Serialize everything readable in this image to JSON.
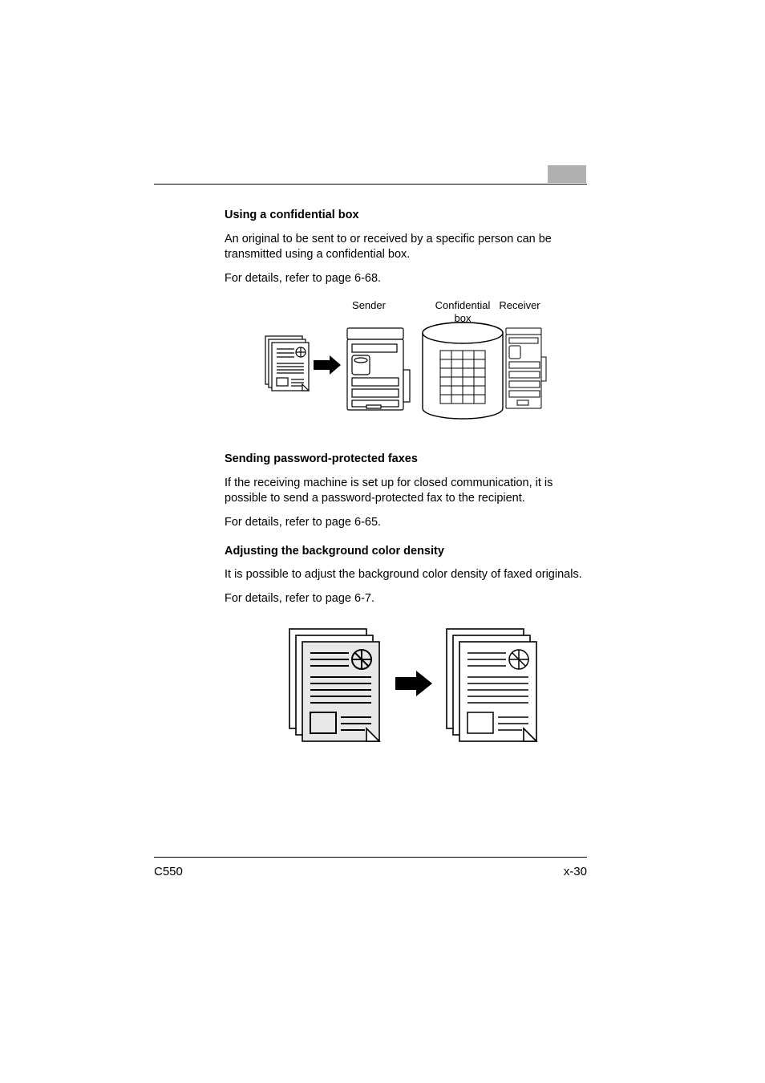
{
  "sections": {
    "s1": {
      "heading": "Using a confidential box",
      "p1": "An original to be sent to or received by a specific person can be transmitted using a confidential box.",
      "p2": "For details, refer to page 6-68."
    },
    "s2": {
      "heading": "Sending password-protected faxes",
      "p1": "If the receiving machine is set up for closed communication, it is possible to send a password-protected fax to the recipient.",
      "p2": "For details, refer to page 6-65."
    },
    "s3": {
      "heading": "Adjusting the background color density",
      "p1": "It is possible to adjust the background color density of faxed originals.",
      "p2": "For details, refer to page 6-7."
    }
  },
  "fig1_labels": {
    "sender": "Sender",
    "confidential": "Confidential box",
    "receiver": "Receiver"
  },
  "footer": {
    "left": "C550",
    "right": "x-30"
  }
}
